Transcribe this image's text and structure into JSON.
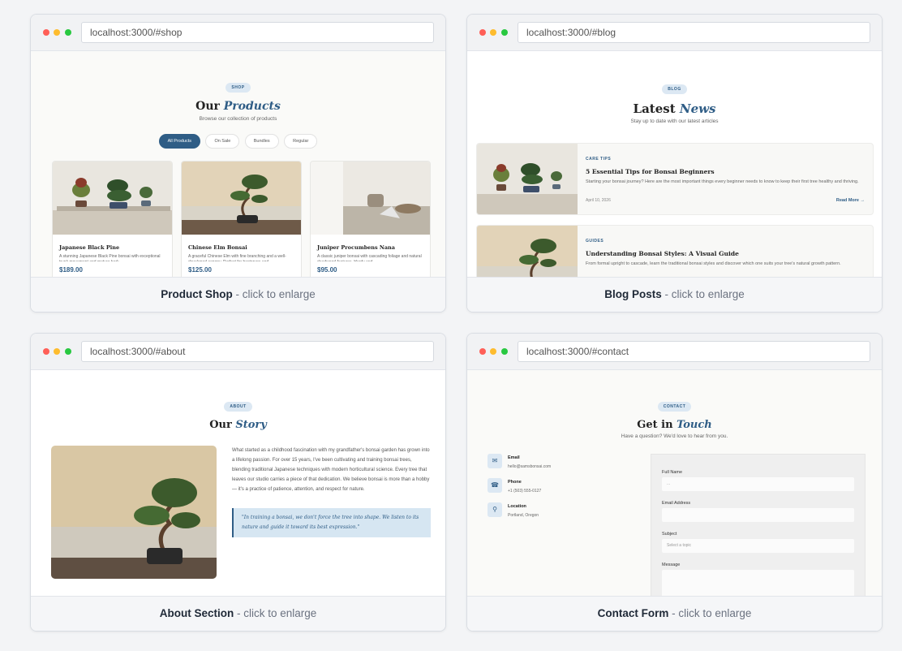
{
  "gallery": [
    {
      "url": "localhost:3000/#shop",
      "caption_title": "Product Shop",
      "caption_hint": " - click to enlarge",
      "page": {
        "pill": "SHOP",
        "heading_plain": "Our ",
        "heading_em": "Products",
        "subtitle": "Browse our collection of products",
        "filters": [
          "All Products",
          "On Sale",
          "Bundles",
          "Regular"
        ],
        "products": [
          {
            "name": "Japanese Black Pine",
            "desc": "A stunning Japanese Black Pine bonsai with exceptional trunk movement and mature bark.",
            "price": "$189.00"
          },
          {
            "name": "Chinese Elm Bonsai",
            "desc": "A graceful Chinese Elm with fine branching and a well-developed canopy. Perfect for beginners and",
            "price": "$125.00"
          },
          {
            "name": "Juniper Procumbens Nana",
            "desc": "A classic juniper bonsai with cascading foliage and natural deadwood features. Hardy and",
            "price": "$95.00"
          }
        ]
      }
    },
    {
      "url": "localhost:3000/#blog",
      "caption_title": "Blog Posts",
      "caption_hint": " - click to enlarge",
      "page": {
        "pill": "BLOG",
        "heading_plain": "Latest ",
        "heading_em": "News",
        "subtitle": "Stay up to date with our latest articles",
        "posts": [
          {
            "category": "CARE TIPS",
            "title": "5 Essential Tips for Bonsai Beginners",
            "excerpt": "Starting your bonsai journey? Here are the most important things every beginner needs to know to keep their first tree healthy and thriving.",
            "date": "April 10, 2026",
            "read_more": "Read More →"
          },
          {
            "category": "GUIDES",
            "title": "Understanding Bonsai Styles: A Visual Guide",
            "excerpt": "From formal upright to cascade, learn the traditional bonsai styles and discover which one suits your tree's natural growth pattern.",
            "date": "",
            "read_more": ""
          }
        ]
      }
    },
    {
      "url": "localhost:3000/#about",
      "caption_title": "About Section",
      "caption_hint": " - click to enlarge",
      "page": {
        "pill": "ABOUT",
        "heading_plain": "Our ",
        "heading_em": "Story",
        "body": "What started as a childhood fascination with my grandfather's bonsai garden has grown into a lifelong passion. For over 15 years, I've been cultivating and training bonsai trees, blending traditional Japanese techniques with modern horticultural science. Every tree that leaves our studio carries a piece of that dedication. We believe bonsai is more than a hobby — it's a practice of patience, attention, and respect for nature.",
        "quote": "\"In training a bonsai, we don't force the tree into shape. We listen to its nature and guide it toward its best expression.\""
      }
    },
    {
      "url": "localhost:3000/#contact",
      "caption_title": "Contact Form",
      "caption_hint": " - click to enlarge",
      "page": {
        "pill": "CONTACT",
        "heading_plain": "Get in ",
        "heading_em": "Touch",
        "subtitle": "Have a question? We'd love to hear from you.",
        "info": [
          {
            "icon": "mail-icon",
            "glyph": "✉",
            "label": "Email",
            "value": "hello@samsbonsai.com"
          },
          {
            "icon": "phone-icon",
            "glyph": "☎",
            "label": "Phone",
            "value": "+1 (503) 555-0127"
          },
          {
            "icon": "location-icon",
            "glyph": "⚲",
            "label": "Location",
            "value": "Portland, Oregon"
          }
        ],
        "form": {
          "full_name_label": "Full Name",
          "full_name_placeholder": "...",
          "email_label": "Email Address",
          "email_placeholder": "",
          "subject_label": "Subject",
          "subject_placeholder": "Select a topic",
          "message_label": "Message"
        }
      }
    }
  ],
  "colors": {
    "accent": "#2f5d86",
    "pill_bg": "#dce8f3",
    "dot_red": "#ff5f57",
    "dot_yellow": "#febc2e",
    "dot_green": "#28c840"
  }
}
